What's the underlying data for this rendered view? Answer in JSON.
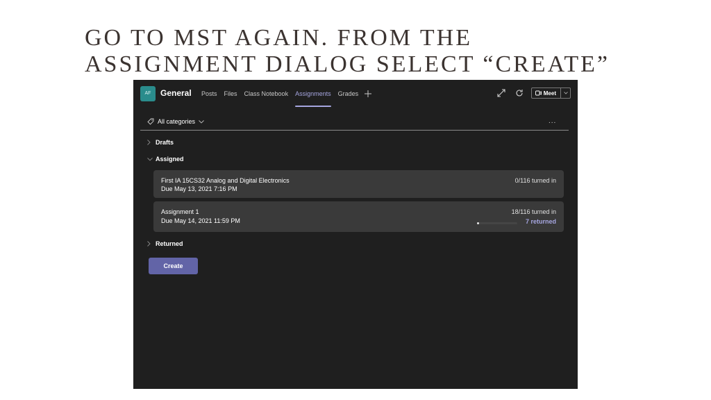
{
  "slide": {
    "title": "GO TO MST AGAIN. FROM THE\nASSIGNMENT DIALOG SELECT “CREATE”"
  },
  "header": {
    "avatar_initials": "AF",
    "channel_name": "General",
    "tabs": [
      {
        "label": "Posts",
        "active": false
      },
      {
        "label": "Files",
        "active": false
      },
      {
        "label": "Class Notebook",
        "active": false
      },
      {
        "label": "Assignments",
        "active": true
      },
      {
        "label": "Grades",
        "active": false
      }
    ],
    "add_tab_icon": "plus-icon",
    "icons": [
      "expand-icon",
      "refresh-icon"
    ],
    "meet_label": "Meet"
  },
  "filter": {
    "label": "All categories",
    "more_label": "..."
  },
  "sections": {
    "drafts": {
      "label": "Drafts",
      "expanded": false
    },
    "assigned": {
      "label": "Assigned",
      "expanded": true
    },
    "returned": {
      "label": "Returned",
      "expanded": false
    }
  },
  "assignments": [
    {
      "title": "First IA 15CS32 Analog and Digital Electronics",
      "due": "Due May 13, 2021 7:16 PM",
      "turned_in": "0/116 turned in",
      "returned": null,
      "returned_fraction": null
    },
    {
      "title": "Assignment 1",
      "due": "Due May 14, 2021 11:59 PM",
      "turned_in": "18/116 turned in",
      "returned": "7 returned",
      "returned_fraction": 0.06
    }
  ],
  "actions": {
    "create_label": "Create"
  },
  "colors": {
    "accent": "#6264a7",
    "accent_light": "#a6a6e0",
    "background": "#1f1f1f",
    "card": "#3a3a3a",
    "avatar": "#2a8c8c"
  }
}
